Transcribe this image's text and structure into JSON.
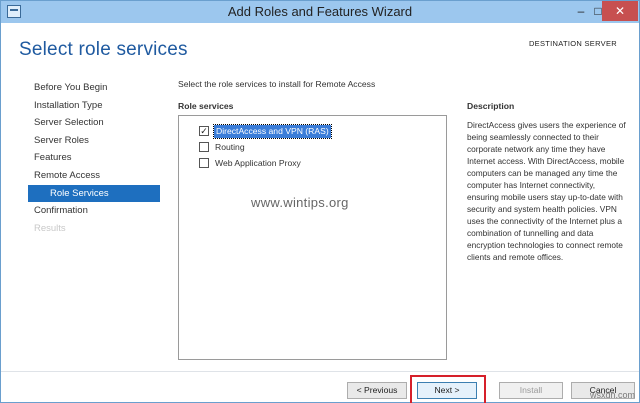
{
  "window": {
    "title": "Add Roles and Features Wizard",
    "controls": {
      "minimize": "–",
      "maximize": "□",
      "close": "✕"
    }
  },
  "header": {
    "page_title": "Select role services",
    "destination": "DESTINATION SERVER"
  },
  "nav": {
    "items": [
      {
        "label": "Before You Begin",
        "state": "normal"
      },
      {
        "label": "Installation Type",
        "state": "normal"
      },
      {
        "label": "Server Selection",
        "state": "normal"
      },
      {
        "label": "Server Roles",
        "state": "normal"
      },
      {
        "label": "Features",
        "state": "normal"
      },
      {
        "label": "Remote Access",
        "state": "normal"
      },
      {
        "label": "Role Services",
        "state": "active"
      },
      {
        "label": "Confirmation",
        "state": "normal"
      },
      {
        "label": "Results",
        "state": "disabled"
      }
    ]
  },
  "main": {
    "instruction": "Select the role services to install for Remote Access",
    "role_services_heading": "Role services",
    "role_services": [
      {
        "label": "DirectAccess and VPN (RAS)",
        "checked": true,
        "selected": true
      },
      {
        "label": "Routing",
        "checked": false,
        "selected": false
      },
      {
        "label": "Web Application Proxy",
        "checked": false,
        "selected": false
      }
    ],
    "description_heading": "Description",
    "description_text": "DirectAccess gives users the experience of being seamlessly connected to their corporate network any time they have Internet access. With DirectAccess, mobile computers can be managed any time the computer has Internet connectivity, ensuring mobile users stay up-to-date with security and system health policies. VPN uses the connectivity of the Internet plus a combination of tunnelling and data encryption technologies to connect remote clients and remote offices."
  },
  "watermark": "www.wintips.org",
  "footer": {
    "previous": "< Previous",
    "next": "Next >",
    "install": "Install",
    "cancel": "Cancel"
  },
  "corner_mark": "wsxdn.com",
  "colors": {
    "titlebar": "#9cc7ee",
    "accent": "#1e6fbf",
    "page_title": "#1f5aa0",
    "highlight_box": "#d6202a"
  }
}
